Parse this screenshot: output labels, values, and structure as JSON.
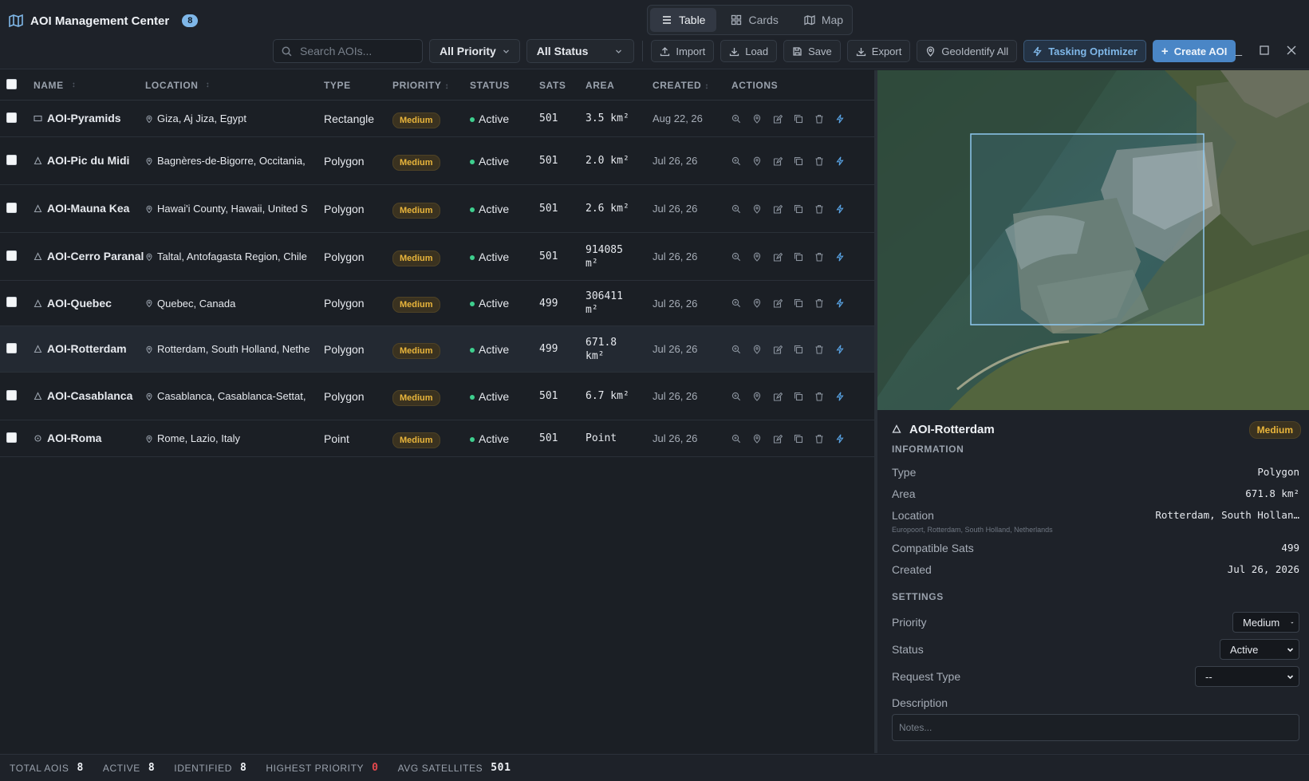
{
  "app": {
    "title": "AOI Management Center",
    "count_badge": "8"
  },
  "views": [
    {
      "label": "Table",
      "icon": "list-icon",
      "active": true
    },
    {
      "label": "Cards",
      "icon": "grid-icon",
      "active": false
    },
    {
      "label": "Map",
      "icon": "map-icon",
      "active": false
    }
  ],
  "toolbar": {
    "search_placeholder": "Search AOIs...",
    "priority_filter": "All Priority",
    "status_filter": "All Status",
    "import_label": "Import",
    "load_label": "Load",
    "save_label": "Save",
    "export_label": "Export",
    "geoidentify_label": "GeoIdentify All",
    "tasking_label": "Tasking Optimizer",
    "create_label": "Create AOI"
  },
  "table": {
    "headers": {
      "name": "NAME",
      "location": "LOCATION",
      "type": "TYPE",
      "priority": "PRIORITY",
      "status": "STATUS",
      "sats": "SATS",
      "area": "AREA",
      "created": "CREATED",
      "actions": "ACTIONS"
    },
    "rows": [
      {
        "shape": "rectangle-icon",
        "name": "AOI-Pyramids",
        "location": "Giza, Aj Jiza, Egypt",
        "type": "Rectangle",
        "priority": "Medium",
        "status": "Active",
        "sats": "501",
        "area": "3.5 km²",
        "created": "Aug 22, 26"
      },
      {
        "shape": "polygon-icon",
        "name": "AOI-Pic du Midi",
        "location": "Bagnères-de-Bigorre, Occitania,",
        "type": "Polygon",
        "priority": "Medium",
        "status": "Active",
        "sats": "501",
        "area": "2.0 km²",
        "created": "Jul 26, 26"
      },
      {
        "shape": "polygon-icon",
        "name": "AOI-Mauna Kea",
        "location": "Hawai'i County, Hawaii, United S",
        "type": "Polygon",
        "priority": "Medium",
        "status": "Active",
        "sats": "501",
        "area": "2.6 km²",
        "created": "Jul 26, 26"
      },
      {
        "shape": "polygon-icon",
        "name": "AOI-Cerro Paranal",
        "location": "Taltal, Antofagasta Region, Chile",
        "type": "Polygon",
        "priority": "Medium",
        "status": "Active",
        "sats": "501",
        "area": "914085 m²",
        "created": "Jul 26, 26"
      },
      {
        "shape": "polygon-icon",
        "name": "AOI-Quebec",
        "location": "Quebec, Canada",
        "type": "Polygon",
        "priority": "Medium",
        "status": "Active",
        "sats": "499",
        "area": "306411 m²",
        "created": "Jul 26, 26"
      },
      {
        "shape": "polygon-icon",
        "name": "AOI-Rotterdam",
        "location": "Rotterdam, South Holland, Nethe",
        "type": "Polygon",
        "priority": "Medium",
        "status": "Active",
        "sats": "499",
        "area": "671.8 km²",
        "created": "Jul 26, 26",
        "selected": true
      },
      {
        "shape": "polygon-icon",
        "name": "AOI-Casablanca",
        "location": "Casablanca, Casablanca-Settat,",
        "type": "Polygon",
        "priority": "Medium",
        "status": "Active",
        "sats": "501",
        "area": "6.7 km²",
        "created": "Jul 26, 26"
      },
      {
        "shape": "point-icon",
        "name": "AOI-Roma",
        "location": "Rome, Lazio, Italy",
        "type": "Point",
        "priority": "Medium",
        "status": "Active",
        "sats": "501",
        "area": "Point",
        "created": "Jul 26, 26"
      }
    ]
  },
  "detail": {
    "title": "AOI-Rotterdam",
    "priority_badge": "Medium",
    "info_heading": "INFORMATION",
    "type_label": "Type",
    "type_value": "Polygon",
    "area_label": "Area",
    "area_value": "671.8 km²",
    "location_label": "Location",
    "location_value": "Rotterdam, South Hollan…",
    "location_full": "Europoort, Rotterdam, South Holland, Netherlands",
    "sats_label": "Compatible Sats",
    "sats_value": "499",
    "created_label": "Created",
    "created_value": "Jul 26, 2026",
    "settings_heading": "SETTINGS",
    "priority_label": "Priority",
    "priority_value": "Medium",
    "status_label": "Status",
    "status_value": "Active",
    "request_label": "Request Type",
    "request_value": "--",
    "description_label": "Description",
    "notes_placeholder": "Notes..."
  },
  "footer": {
    "total_label": "TOTAL AOIS",
    "total_value": "8",
    "active_label": "ACTIVE",
    "active_value": "8",
    "identified_label": "IDENTIFIED",
    "identified_value": "8",
    "highest_label": "HIGHEST PRIORITY",
    "highest_value": "0",
    "avg_label": "AVG SATELLITES",
    "avg_value": "501"
  },
  "colors": {
    "accent": "#4a86c6",
    "medium": "#e9b53b",
    "active": "#3ecf8e",
    "alert": "#e5484d"
  }
}
